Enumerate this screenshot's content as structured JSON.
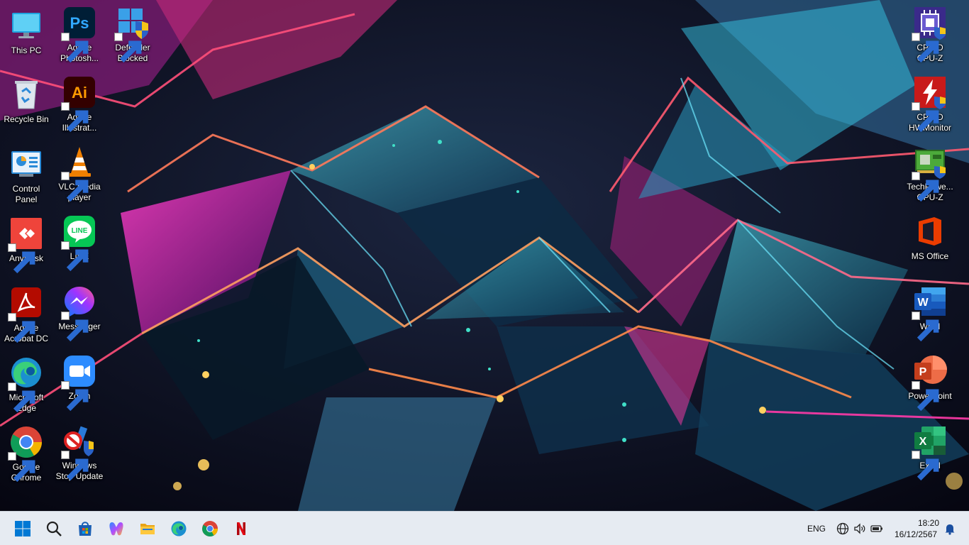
{
  "desktop": {
    "left_icons": [
      {
        "id": "this-pc",
        "label": "This PC",
        "icon": "monitor-icon"
      },
      {
        "id": "adobe-photoshop",
        "label": "Adobe\nPhotosh...",
        "icon": "photoshop-icon"
      },
      {
        "id": "defender-blocked",
        "label": "Defender\nBlocked",
        "icon": "defender-shield-icon"
      },
      {
        "id": "recycle-bin",
        "label": "Recycle Bin",
        "icon": "recycle-bin-icon"
      },
      {
        "id": "adobe-illustrator",
        "label": "Adobe\nIllustrat...",
        "icon": "illustrator-icon"
      },
      {
        "id": "control-panel",
        "label": "Control\nPanel",
        "icon": "control-panel-icon"
      },
      {
        "id": "vlc",
        "label": "VLC media\nplayer",
        "icon": "vlc-cone-icon"
      },
      {
        "id": "anydesk",
        "label": "AnyDesk",
        "icon": "anydesk-icon"
      },
      {
        "id": "line",
        "label": "LINE",
        "icon": "line-chat-icon"
      },
      {
        "id": "acrobat",
        "label": "Adobe\nAcrobat DC",
        "icon": "acrobat-icon"
      },
      {
        "id": "messenger",
        "label": "Messenger",
        "icon": "messenger-icon"
      },
      {
        "id": "edge",
        "label": "Microsoft\nEdge",
        "icon": "edge-icon"
      },
      {
        "id": "zoom",
        "label": "Zoom",
        "icon": "zoom-camera-icon"
      },
      {
        "id": "chrome",
        "label": "Google\nChrome",
        "icon": "chrome-icon"
      },
      {
        "id": "windows-stop-update",
        "label": "Windows\nStop Update",
        "icon": "stop-update-icon"
      }
    ],
    "right_icons": [
      {
        "id": "cpuz",
        "label": "CPUID\nCPU-Z",
        "icon": "cpu-chip-icon"
      },
      {
        "id": "hwmonitor",
        "label": "CPUID\nHWMonitor",
        "icon": "hwmonitor-icon"
      },
      {
        "id": "gpuz",
        "label": "TechPowe...\nGPU-Z",
        "icon": "gpu-card-icon"
      },
      {
        "id": "ms-office",
        "label": "MS Office",
        "icon": "office-icon"
      },
      {
        "id": "word",
        "label": "Word",
        "icon": "word-icon"
      },
      {
        "id": "powerpoint",
        "label": "PowerPoint",
        "icon": "powerpoint-icon"
      },
      {
        "id": "excel",
        "label": "Excel",
        "icon": "excel-icon"
      }
    ]
  },
  "taskbar": {
    "buttons": [
      {
        "id": "start",
        "icon": "windows-logo-icon"
      },
      {
        "id": "search",
        "icon": "search-icon"
      },
      {
        "id": "store",
        "icon": "store-bag-icon"
      },
      {
        "id": "copilot",
        "icon": "copilot-icon"
      },
      {
        "id": "file-explorer",
        "icon": "folder-icon"
      },
      {
        "id": "edge",
        "icon": "edge-icon"
      },
      {
        "id": "chrome",
        "icon": "chrome-icon"
      },
      {
        "id": "netflix",
        "icon": "netflix-icon"
      }
    ],
    "tray": {
      "language": "ENG",
      "time": "18:20",
      "date": "16/12/2567",
      "icons": [
        "globe-icon",
        "speaker-icon",
        "battery-icon",
        "bell-icon"
      ]
    }
  },
  "colors": {
    "taskbar_bg": "#e6ebf2",
    "accent_blue": "#0067c0"
  }
}
